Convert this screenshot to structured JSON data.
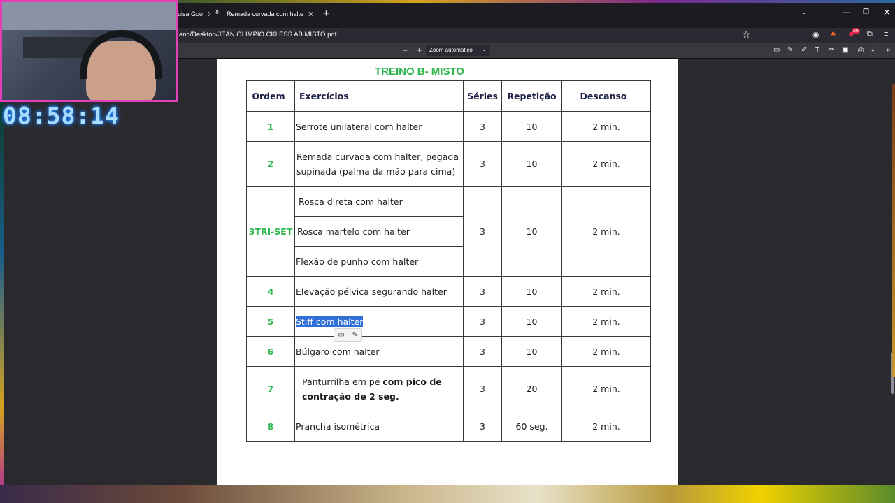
{
  "browser": {
    "tabs": [
      {
        "label": "uisa Goo"
      },
      {
        "label": "Remada curvada com halteres:"
      }
    ],
    "new_tab_symbol": "+",
    "url": "anc/Desktop/JEAN OLIMPIO CKLESS AB MISTO.pdf",
    "notification_count": "26"
  },
  "pdf_toolbar": {
    "zoom_out": "−",
    "zoom_in": "+",
    "zoom_value": "Zoom automático"
  },
  "stream": {
    "timer": "08:58:14"
  },
  "document": {
    "title": "TREINO B- MISTO",
    "headers": {
      "ordem": "Ordem",
      "exercicios": "Exercícios",
      "series": "Séries",
      "repeticao": "Repetição",
      "descanso": "Descanso"
    },
    "rows": [
      {
        "ordem": "1",
        "exercicio": "Serrote unilateral com halter",
        "series": "3",
        "repeticao": "10",
        "descanso": "2 min."
      },
      {
        "ordem": "2",
        "exercicio_l1": "Remada curvada com halter, pegada",
        "exercicio_l2": "supinada (palma da mão para cima)",
        "series": "3",
        "repeticao": "10",
        "descanso": "2 min."
      },
      {
        "ordem": "3TRI-SET",
        "exercicios": [
          "Rosca direta com halter",
          "Rosca martelo com halter",
          "Flexão de punho com halter"
        ],
        "series": "3",
        "repeticao": "10",
        "descanso": "2 min."
      },
      {
        "ordem": "4",
        "exercicio": "Elevação pélvica segurando halter",
        "series": "3",
        "repeticao": "10",
        "descanso": "2 min."
      },
      {
        "ordem": "5",
        "exercicio": "Stiff com halter",
        "series": "3",
        "repeticao": "10",
        "descanso": "2 min."
      },
      {
        "ordem": "6",
        "exercicio": "Búlgaro com halter",
        "series": "3",
        "repeticao": "10",
        "descanso": "2 min."
      },
      {
        "ordem": "7",
        "exercicio_pre": "Panturrilha em pé ",
        "exercicio_bold_l1": "com pico de",
        "exercicio_bold_l2": "contração de 2 seg.",
        "series": "3",
        "repeticao": "20",
        "descanso": "2 min."
      },
      {
        "ordem": "8",
        "exercicio": "Prancha isométrica",
        "series": "3",
        "repeticao": "60 seg.",
        "descanso": "2 min."
      }
    ]
  },
  "icons": {
    "tab_close": "close-icon",
    "star": "star-icon",
    "comment": "comment-icon",
    "pencil": "pencil-icon"
  }
}
